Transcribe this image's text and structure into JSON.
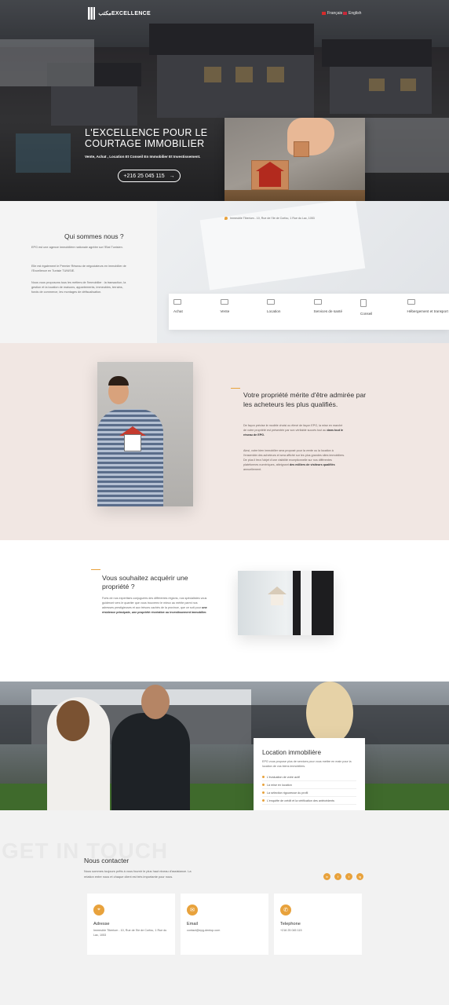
{
  "header": {
    "logo_text": "مكتبEXCELLENCE",
    "lang_fr": "Français",
    "lang_en": "English"
  },
  "hero": {
    "title": "L'EXCELLENCE POUR LE COURTAGE IMMOBILIER",
    "subtitle": "Vente, Achat , Location Et Conseil En Immobilier Et Investissement.",
    "phone": "+216 25 045 115",
    "arrow": "→"
  },
  "about": {
    "address": "Immeuble Tiberium - 10, Rue de l'Ile de Corfou, 1 Rue du Lac, 1053",
    "title": "Qui sommes nous ?",
    "p1": "EPG est une agence immobilière nationale agréée sur l'Etat Tunisien.",
    "p2": "Elle est également le Premier Réseau de négociateurs en immobilier de l'Excellence en Tunisie TUNISIE.",
    "p3": "Nous vous proposons tous les métiers de l'immobilier : la transaction, la gestion et la location de maisons, appartements, immeubles, terrains, fonds de commerce, les montages de défiscalisation."
  },
  "services": [
    {
      "label": "Achat",
      "icon": "building-icon"
    },
    {
      "label": "Vente",
      "icon": "sale-icon"
    },
    {
      "label": "Location",
      "icon": "key-icon"
    },
    {
      "label": "Services de santé",
      "icon": "health-icon"
    },
    {
      "label": "Conseil",
      "icon": "advice-icon"
    },
    {
      "label": "Hébergement et transport",
      "icon": "transport-icon"
    }
  ],
  "propriete": {
    "title": "Votre propriété mérite d'être admirée par les acheteurs les plus qualifiés.",
    "p1_a": "De façon précise le modèle choisi ou élevé de façon EPG, la mise en marché de votre propriété est présentée par son véritable succès tout au",
    "p1_b": "dans tout le réseau de EPG.",
    "p2_a": "Ainsi, votre bien immobilier sera proposé pour la vente ou la location à l'ensemble des acheteurs et sera affiché sur les plus grandes sites immobiliers. De plus il fera l'objet d'une visibilité exceptionnelle sur nos différentes plateformes numériques, atteignant",
    "p2_b": "des milliers de visiteurs qualifiés",
    "p2_c": "annuellement."
  },
  "acquerir": {
    "title": "Vous souhaitez acquérir une propriété ?",
    "text_a": "Forts de nos expertises conjuguées des différentes régions, nos spécialistes vous guideront vers le quartier que vous trouverez le mieux au mérite parmi nos adresses prestigieuses et aux trésors cachés de la province, que ce soit pour",
    "text_b": "une résidence principale, une propriété récréative ou investissement immobilier."
  },
  "location": {
    "title": "Location immobilière",
    "desc": "EPG vous propose plus de services pour vous mettre en main pour la location de vos biens immobiliers.",
    "items": [
      "L'évaluation de votre actif",
      "La mise en location",
      "La sélection rigoureuse du profil",
      "L'enquête de crédit et la vérification des antécédents"
    ]
  },
  "contact": {
    "ghost": "GET IN TOUCH",
    "title": "Nous contacter",
    "text": "Nous sommes toujours prêts à vous fournir le plus haut niveau d'assistance. La relation entre nous et chaque client est très importante pour nous.",
    "socials": [
      "in",
      "f",
      "t",
      "ig"
    ],
    "cards": [
      {
        "label": "Adresse",
        "value": "Immeuble Tiberium - 10, Rue de l'Ile de Corfou, 1 Rue du Lac, 1053",
        "icon": "pin-icon",
        "glyph": "⌖"
      },
      {
        "label": "Email",
        "value": "contact@epg-dentop.com",
        "icon": "mail-icon",
        "glyph": "✉"
      },
      {
        "label": "Telephone",
        "value": "+216 25 045 115",
        "icon": "phone-icon",
        "glyph": "✆"
      }
    ]
  },
  "colors": {
    "accent": "#e8a23c",
    "pink_bg": "#f1e7e3",
    "grey_bg": "#f2f2f2"
  }
}
